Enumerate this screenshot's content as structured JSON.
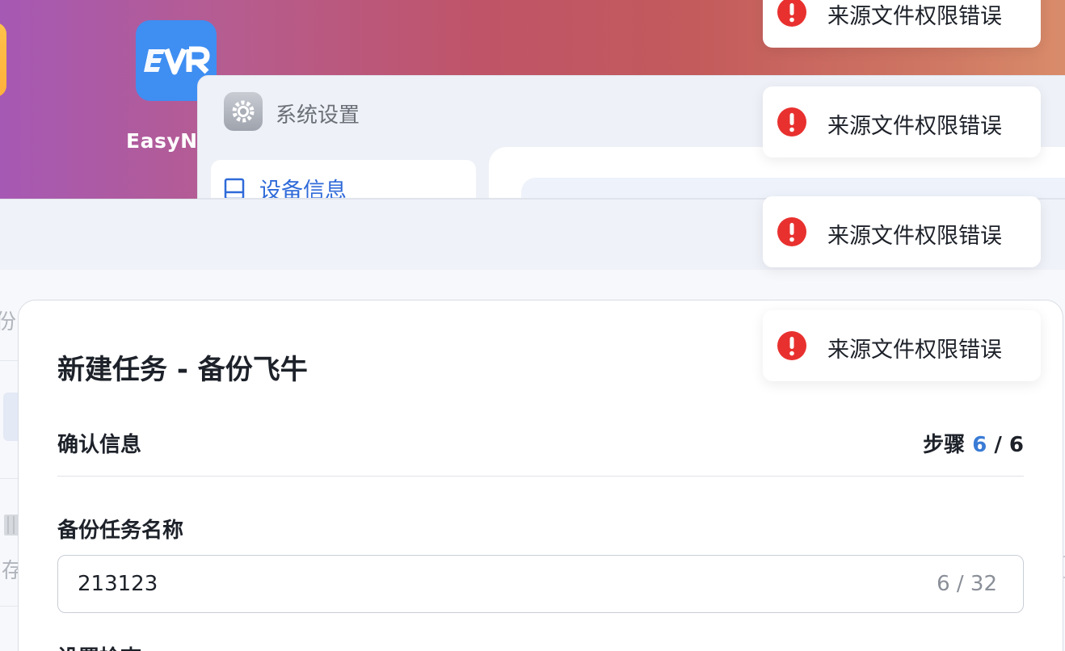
{
  "desktop": {
    "app_label": "EasyN",
    "app_icon": "evr-logo-icon",
    "accent": "#3f8ef2"
  },
  "settings_window": {
    "title": "系统设置",
    "title_icon": "gear-icon",
    "sidebar": {
      "items": [
        {
          "label": "设备信息",
          "icon": "device-icon"
        }
      ]
    }
  },
  "background_page": {
    "ghost_texts": [
      "份",
      "存"
    ]
  },
  "dialog": {
    "title": "新建任务 - 备份飞牛",
    "section_title": "确认信息",
    "step": {
      "prefix": "步骤 ",
      "current": "6",
      "separator": " / ",
      "total": "6"
    },
    "fields": {
      "task_name": {
        "label": "备份任务名称",
        "value": "213123",
        "char_count": "6 / 32"
      }
    },
    "next_section_label": "设置检查"
  },
  "toasts": [
    {
      "message": "来源文件权限错误",
      "icon": "error-icon",
      "color": "#e8312f"
    },
    {
      "message": "来源文件权限错误",
      "icon": "error-icon",
      "color": "#e8312f"
    },
    {
      "message": "来源文件权限错误",
      "icon": "error-icon",
      "color": "#e8312f"
    },
    {
      "message": "来源文件权限错误",
      "icon": "error-icon",
      "color": "#e8312f"
    }
  ]
}
